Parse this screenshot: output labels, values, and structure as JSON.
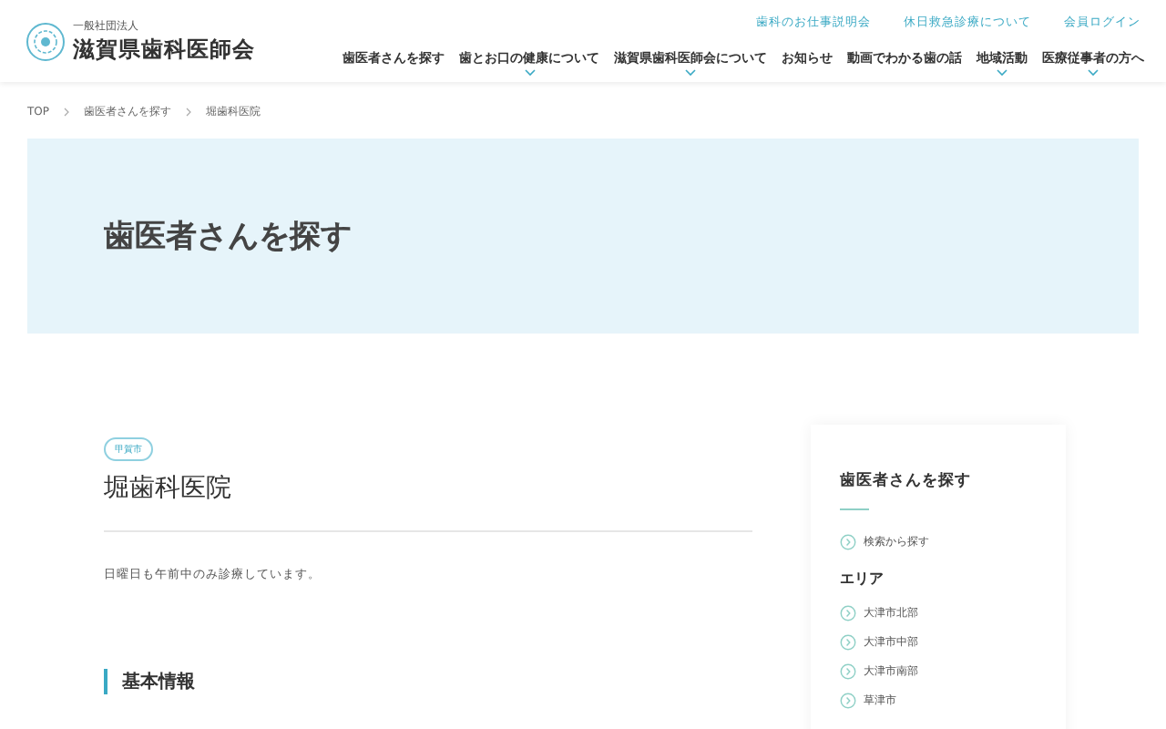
{
  "header": {
    "logo_sub": "一般社団法人",
    "logo_title": "滋賀県歯科医師会",
    "top_links": [
      "歯科のお仕事説明会",
      "休日救急診療について",
      "会員ログイン"
    ],
    "nav": [
      {
        "label": "歯医者さんを探す",
        "has_dropdown": false
      },
      {
        "label": "歯とお口の健康について",
        "has_dropdown": true
      },
      {
        "label": "滋賀県歯科医師会について",
        "has_dropdown": true
      },
      {
        "label": "お知らせ",
        "has_dropdown": false
      },
      {
        "label": "動画でわかる歯の話",
        "has_dropdown": false
      },
      {
        "label": "地域活動",
        "has_dropdown": true
      },
      {
        "label": "医療従事者の方へ",
        "has_dropdown": true
      }
    ]
  },
  "breadcrumb": [
    "TOP",
    "歯医者さんを探す",
    "堀歯科医院"
  ],
  "hero": {
    "title": "歯医者さんを探す"
  },
  "clinic": {
    "area_tag": "甲賀市",
    "name": "堀歯科医院",
    "note": "日曜日も午前中のみ診療しています。",
    "section_title": "基本情報"
  },
  "sidebar": {
    "title": "歯医者さんを探す",
    "links": [
      "検索から探す"
    ],
    "area_title": "エリア",
    "areas": [
      "大津市北部",
      "大津市中部",
      "大津市南部",
      "草津市"
    ]
  }
}
